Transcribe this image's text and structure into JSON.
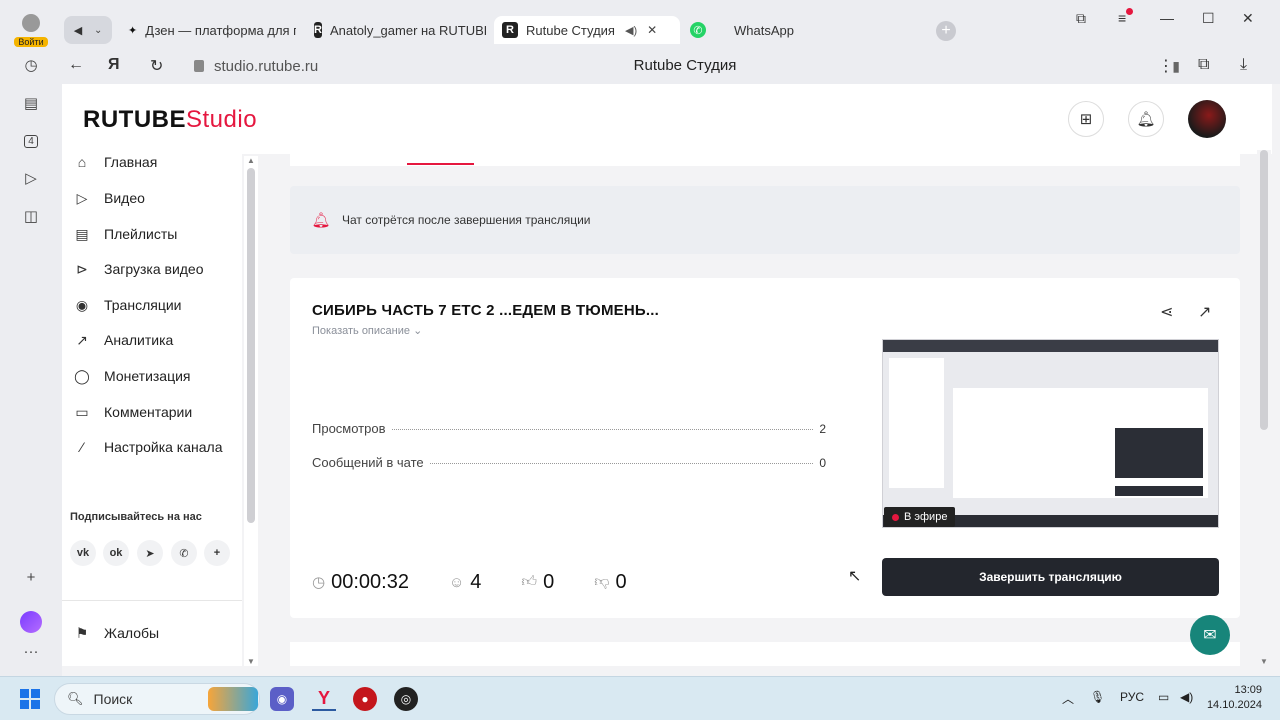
{
  "browser": {
    "login_label": "Войти",
    "tabs": [
      {
        "label": "Дзен — платформа для п",
        "icon": "dzen-icon"
      },
      {
        "label": "Anatoly_gamer на RUTUBE",
        "icon": "rutube-icon"
      },
      {
        "label": "Rutube Студия",
        "icon": "rutube-icon",
        "active": true
      },
      {
        "label": "WhatsApp",
        "icon": "whatsapp-icon"
      }
    ],
    "url": "studio.rutube.ru",
    "page_title": "Rutube Студия"
  },
  "header": {
    "logo_main": "RUTUBE",
    "logo_studio": "Studio"
  },
  "sidebar": {
    "items": [
      {
        "label": "Главная",
        "icon": "home-icon"
      },
      {
        "label": "Видео",
        "icon": "video-icon"
      },
      {
        "label": "Плейлисты",
        "icon": "playlist-icon"
      },
      {
        "label": "Загрузка видео",
        "icon": "upload-icon"
      },
      {
        "label": "Трансляции",
        "icon": "broadcast-icon"
      },
      {
        "label": "Аналитика",
        "icon": "analytics-icon"
      },
      {
        "label": "Монетизация",
        "icon": "coin-icon"
      },
      {
        "label": "Комментарии",
        "icon": "comments-icon"
      },
      {
        "label": "Настройка канала",
        "icon": "wand-icon"
      }
    ],
    "subscribe_label": "Подписывайтесь на нас",
    "socials": [
      {
        "label": "vk",
        "icon": "vk-icon"
      },
      {
        "label": "ok",
        "icon": "ok-icon"
      },
      {
        "label": "telegram",
        "icon": "telegram-icon"
      },
      {
        "label": "viber",
        "icon": "viber-icon"
      },
      {
        "label": "more",
        "icon": "plus-icon"
      }
    ],
    "complaints_label": "Жалобы"
  },
  "main": {
    "notice": "Чат сотрётся после завершения трансляции",
    "stream": {
      "title": "СИБИРЬ ЧАСТЬ 7 ETC 2 ...ЕДЕМ В ТЮМЕНЬ...",
      "show_description": "Показать описание",
      "stats": [
        {
          "label": "Просмотров",
          "value": "2"
        },
        {
          "label": "Сообщений в чате",
          "value": "0"
        }
      ],
      "live_badge": "В эфире",
      "duration": "00:00:32",
      "viewers": "4",
      "likes": "0",
      "dislikes": "0",
      "end_button": "Завершить трансляцию"
    }
  },
  "taskbar": {
    "search_placeholder": "Поиск",
    "language": "РУС",
    "time": "13:09",
    "date": "14.10.2024"
  },
  "colors": {
    "brand_red": "#e5173f",
    "dark_button": "#23262d",
    "support_teal": "#17857a"
  }
}
